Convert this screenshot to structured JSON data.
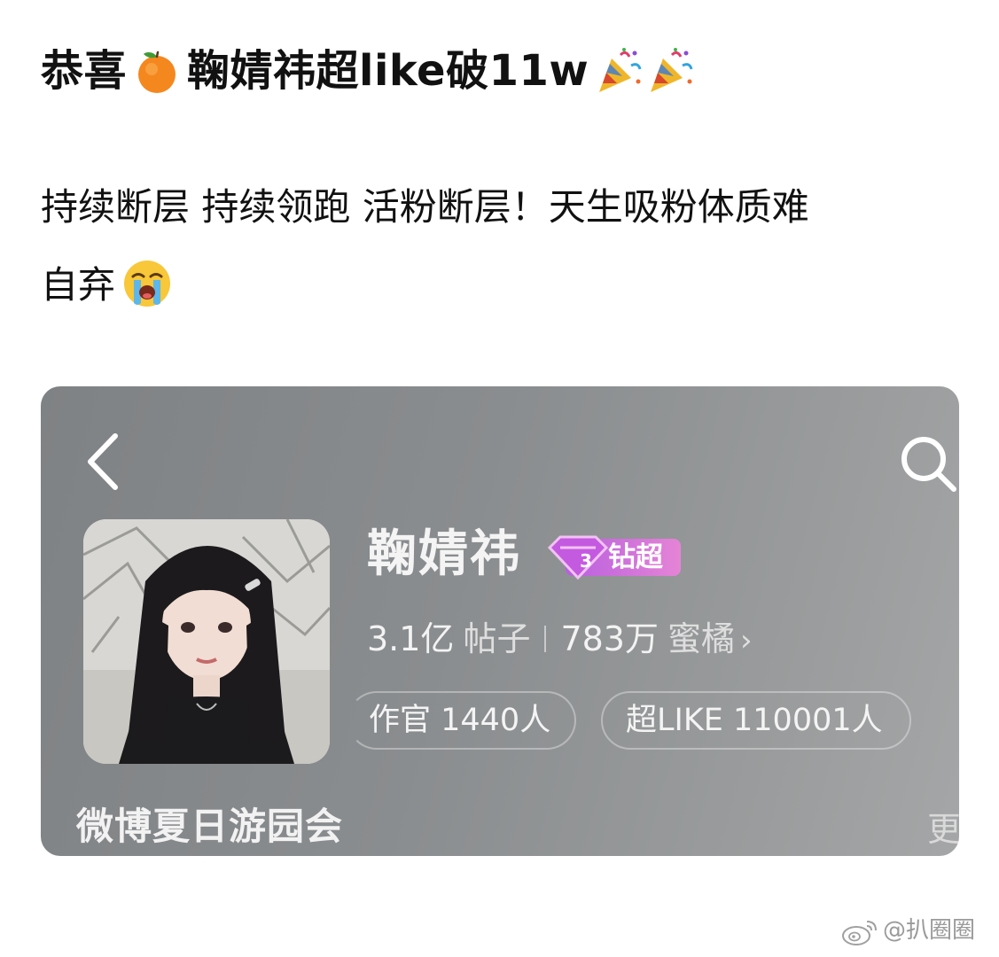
{
  "post": {
    "title_part1": "恭喜",
    "title_part2": "鞠婧祎超like破11w",
    "title_icons": [
      "tangerine-emoji",
      "party-popper-emoji",
      "party-popper-emoji"
    ],
    "body_line1": "持续断层 持续领跑 活粉断层！天生吸粉体质难",
    "body_line2": "自弃",
    "body_icon": "loudly-crying-face-emoji"
  },
  "card": {
    "name": "鞠婧祎",
    "badge_label": "钻超",
    "badge_level": "3",
    "posts_count": "3.1亿",
    "posts_label": "帖子",
    "fans_count": "783万",
    "fans_label": "蜜橘",
    "pill_1": "作官 1440人",
    "pill_2": "超LIKE 110001人",
    "footer_title": "微博夏日游园会",
    "more_label": "更",
    "colors": {
      "card_bg": "#8a8d8f",
      "badge_gradient_start": "#c86be0",
      "badge_gradient_end": "#e87fd6"
    }
  },
  "watermark": {
    "text": "@扒圈圈",
    "icon": "weibo-logo-icon"
  }
}
